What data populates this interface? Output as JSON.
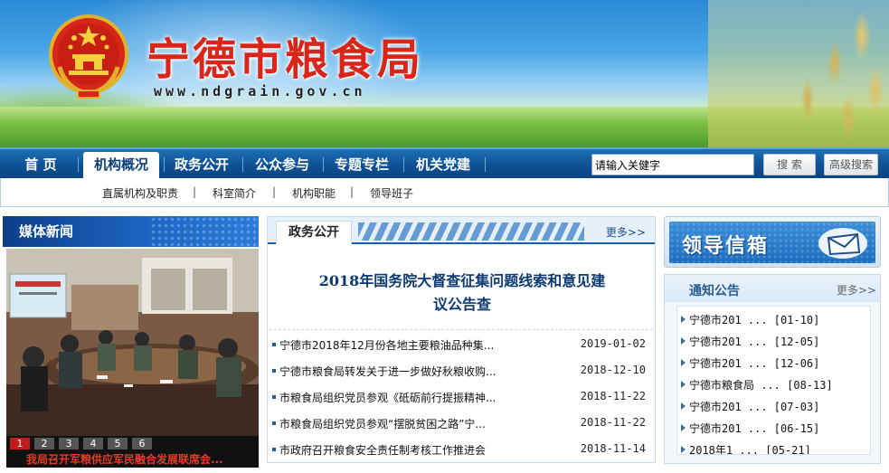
{
  "banner": {
    "title": "宁德市粮食局",
    "url": "www.ndgrain.gov.cn"
  },
  "nav": {
    "items": [
      "首 页",
      "机构概况",
      "政务公开",
      "公众参与",
      "专题专栏",
      "机关党建"
    ],
    "active": "机构概况",
    "search_placeholder": "请输入关健字",
    "search_button": "搜 索",
    "advanced_search_button": "高级搜索"
  },
  "subnav": {
    "items": [
      "直属机构及职责",
      "科室简介",
      "机构职能",
      "领导班子"
    ],
    "separator": "|"
  },
  "media": {
    "title": "媒体新闻",
    "slides": [
      "1",
      "2",
      "3",
      "4",
      "5",
      "6"
    ],
    "active_slide": "1",
    "caption": "我局召开军粮供应军民融合发展联席会..."
  },
  "gov": {
    "tab_label": "政务公开",
    "more_label": "更多>>",
    "headline_line1": "2018年国务院大督查征集问题线索和意见建",
    "headline_line2": "议公告查",
    "items": [
      {
        "title": "宁德市2018年12月份各地主要粮油品种集...",
        "date": "2019-01-02"
      },
      {
        "title": "宁德市粮食局转发关于进一步做好秋粮收购...",
        "date": "2018-12-10"
      },
      {
        "title": "市粮食局组织党员参观《砥砺前行提振精神...",
        "date": "2018-11-22"
      },
      {
        "title": "市粮食局组织党员参观“摆脱贫困之路”宁...",
        "date": "2018-11-22"
      },
      {
        "title": "市政府召开粮食安全责任制考核工作推进会",
        "date": "2018-11-14"
      }
    ]
  },
  "mailbox": {
    "label": "领导信箱"
  },
  "notice": {
    "title": "通知公告",
    "more_label": "更多>>",
    "items": [
      "宁德市201 ... [01-10]",
      "宁德市201 ... [12-05]",
      "宁德市201 ... [12-06]",
      "宁德市粮食局 ... [08-13]",
      "宁德市201 ... [07-03]",
      "宁德市201 ... [06-15]",
      "2018年1 ... [05-21]"
    ]
  },
  "colors": {
    "title_red": "#d8261a",
    "nav_blue": "#0f5295",
    "headline_blue": "#0d3a72",
    "caption_red": "#e63b28"
  }
}
